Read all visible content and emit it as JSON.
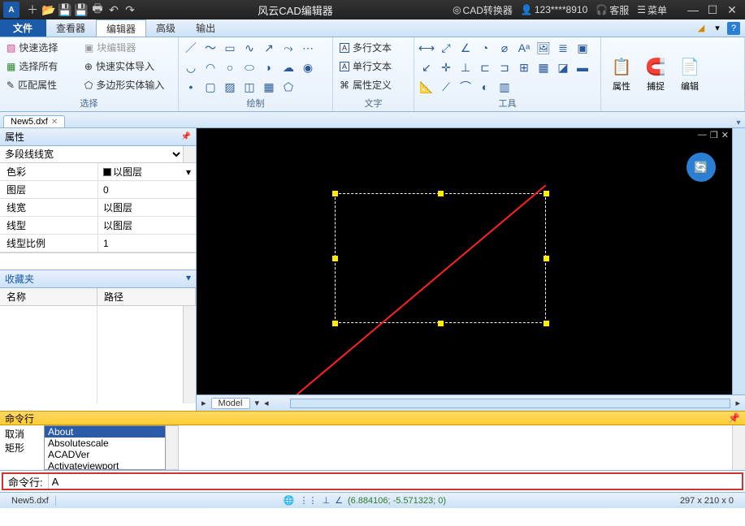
{
  "titlebar": {
    "app_abbrev": "A",
    "title": "风云CAD编辑器",
    "converter": "CAD转换器",
    "user": "123****8910",
    "service": "客服",
    "menu": "菜单"
  },
  "menubar": {
    "file": "文件",
    "viewer": "查看器",
    "editor": "编辑器",
    "advanced": "高级",
    "output": "输出"
  },
  "ribbon": {
    "select": {
      "quick_select": "快速选择",
      "select_all": "选择所有",
      "match_props": "匹配属性",
      "block_editor": "块编辑器",
      "quick_import": "快速实体导入",
      "polygon_input": "多边形实体输入",
      "label": "选择"
    },
    "draw_label": "绘制",
    "text": {
      "mtext": "多行文本",
      "stext": "单行文本",
      "attdef": "属性定义",
      "label": "文字"
    },
    "tools_label": "工具",
    "props": "属性",
    "snap": "捕捉",
    "edit": "编辑"
  },
  "tab": {
    "name": "New5.dxf"
  },
  "props_panel": {
    "title": "属性",
    "selector": "多段线线宽",
    "rows": {
      "color_k": "色彩",
      "color_v": "以图层",
      "layer_k": "图层",
      "layer_v": "0",
      "lw_k": "线宽",
      "lw_v": "以图层",
      "lt_k": "线型",
      "lt_v": "以图层",
      "lts_k": "线型比例",
      "lts_v": "1"
    },
    "fav_title": "收藏夹",
    "fav_name": "名称",
    "fav_path": "路径"
  },
  "canvas": {
    "model_tab": "Model"
  },
  "cmd": {
    "head": "命令行",
    "cancel": "取消",
    "rect": "矩形",
    "suggestions": [
      "About",
      "Absolutescale",
      "ACADVer",
      "Activateviewport"
    ],
    "prompt": "命令行:",
    "input": "A"
  },
  "status": {
    "file": "New5.dxf",
    "coords": "(6.884106; -5.571323; 0)",
    "dims": "297 x 210 x 0"
  },
  "chart_data": {
    "type": "table",
    "title": "属性",
    "rows": [
      {
        "key": "色彩",
        "value": "以图层"
      },
      {
        "key": "图层",
        "value": "0"
      },
      {
        "key": "线宽",
        "value": "以图层"
      },
      {
        "key": "线型",
        "value": "以图层"
      },
      {
        "key": "线型比例",
        "value": "1"
      }
    ]
  }
}
